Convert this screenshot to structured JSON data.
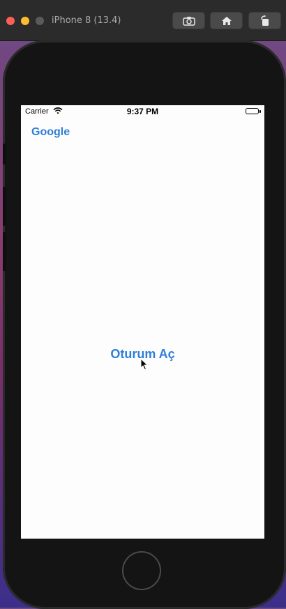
{
  "window": {
    "title": "iPhone 8 (13.4)",
    "toolbar": {
      "screenshot_icon": "camera-icon",
      "home_icon": "home-icon",
      "rotate_icon": "rotate-icon"
    }
  },
  "status_bar": {
    "carrier": "Carrier",
    "time": "9:37 PM",
    "wifi_icon": "wifi-icon",
    "battery_icon": "battery-icon"
  },
  "app": {
    "google_link": "Google",
    "sign_in_button": "Oturum Aç"
  },
  "colors": {
    "accent": "#2f7ed8",
    "screen_background": "#fdfdfd",
    "device_bezel": "#141414"
  }
}
